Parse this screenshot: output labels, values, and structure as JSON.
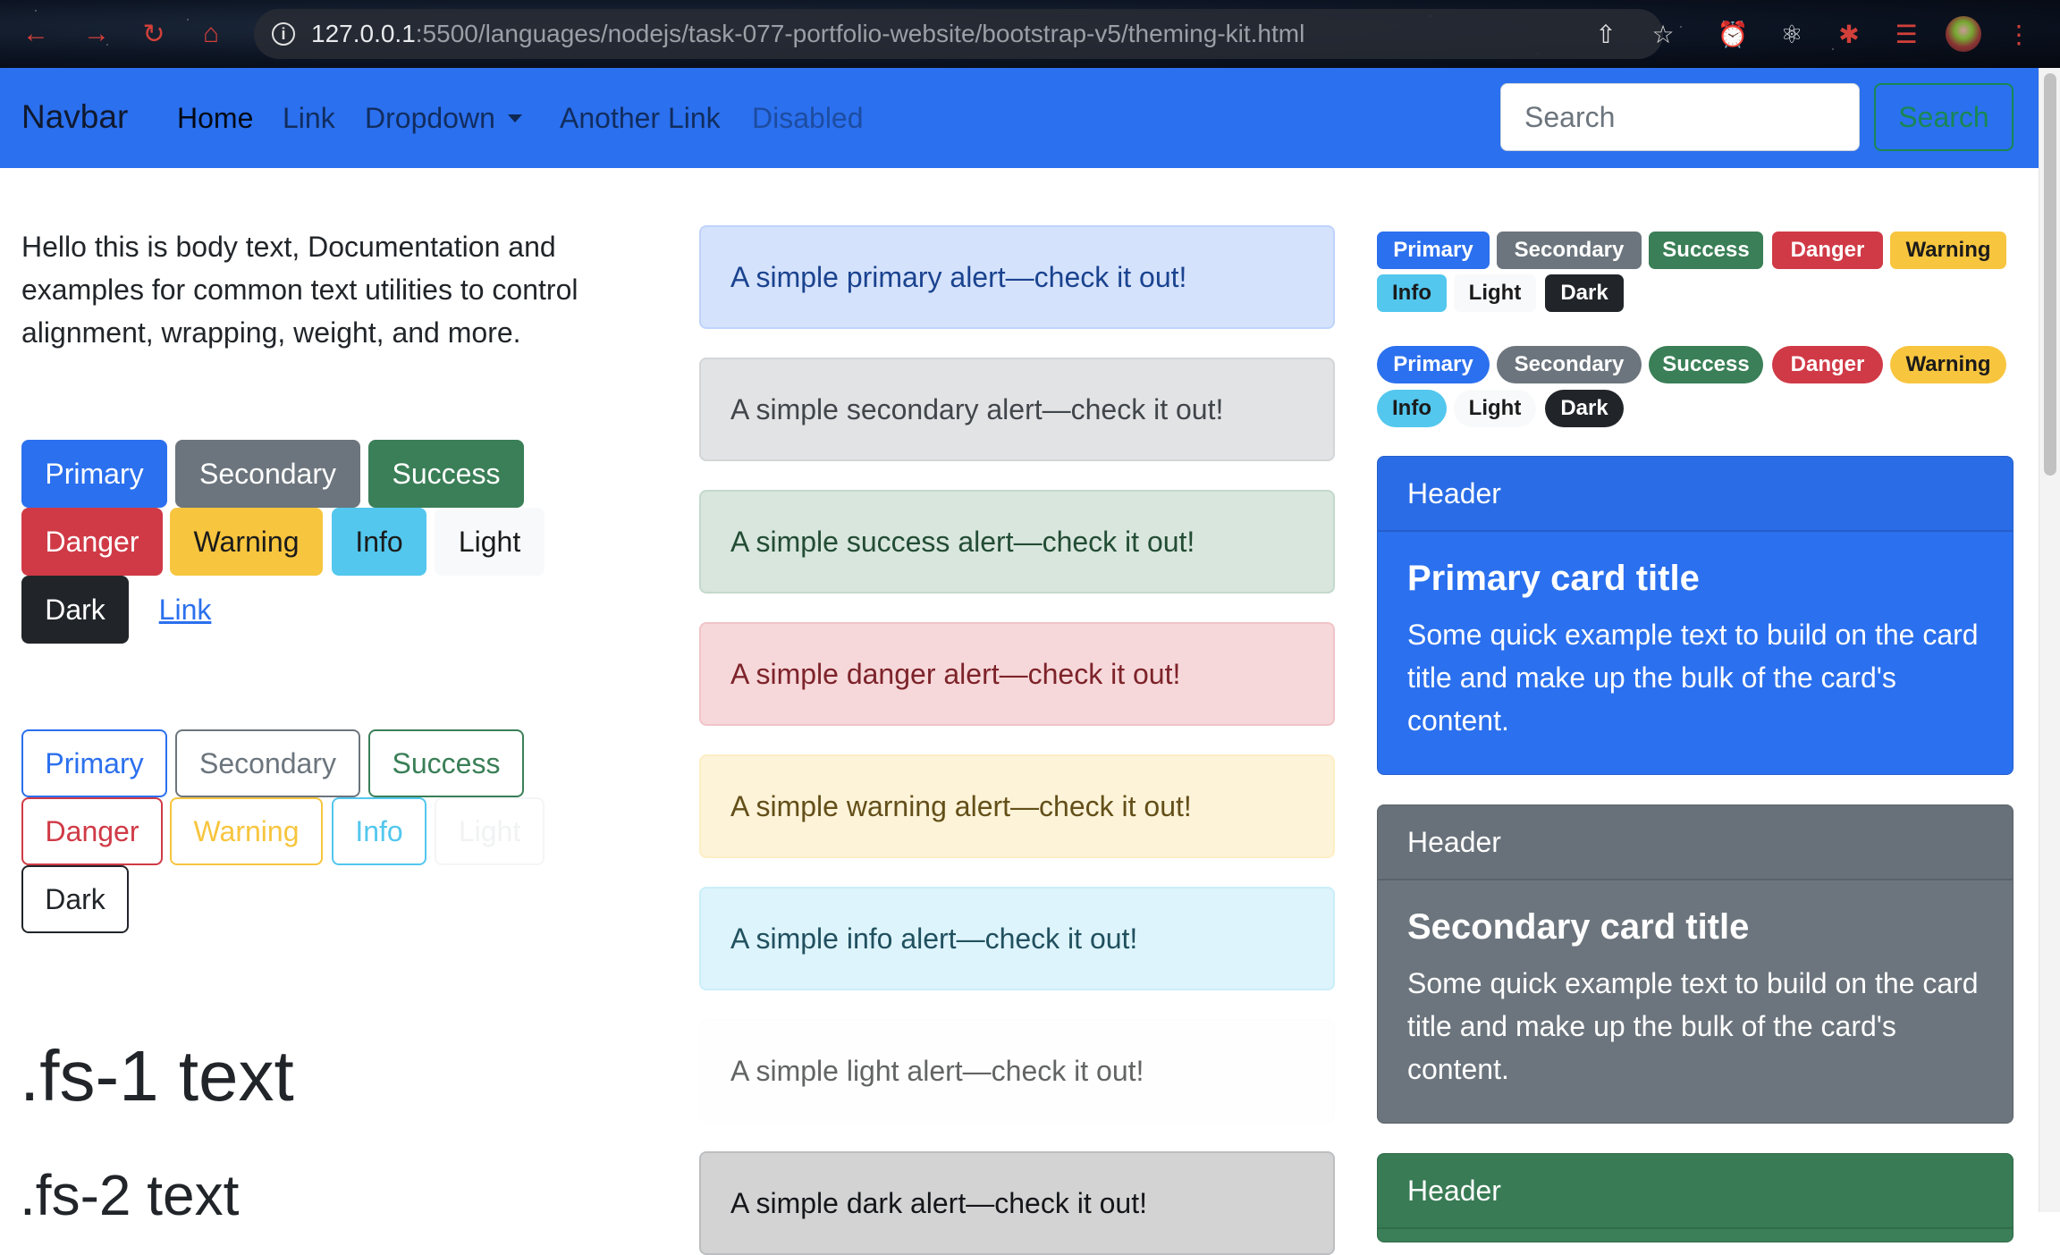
{
  "browser": {
    "url_host": "127.0.0.1",
    "url_path": ":5500/languages/nodejs/task-077-portfolio-website/bootstrap-v5/theming-kit.html"
  },
  "navbar": {
    "brand": "Navbar",
    "links": [
      "Home",
      "Link",
      "Dropdown",
      "Another Link",
      "Disabled"
    ],
    "search_placeholder": "Search",
    "search_button": "Search"
  },
  "body_text": "Hello this is body text, Documentation and examples for common text utilities to control alignment, wrapping, weight, and more.",
  "buttons": [
    "Primary",
    "Secondary",
    "Success",
    "Danger",
    "Warning",
    "Info",
    "Light",
    "Dark",
    "Link"
  ],
  "outline_buttons": [
    "Primary",
    "Secondary",
    "Success",
    "Danger",
    "Warning",
    "Info",
    "Light",
    "Dark"
  ],
  "headings": {
    "fs1": ".fs-1 text",
    "fs2": ".fs-2 text"
  },
  "alerts": [
    "A simple primary alert—check it out!",
    "A simple secondary alert—check it out!",
    "A simple success alert—check it out!",
    "A simple danger alert—check it out!",
    "A simple warning alert—check it out!",
    "A simple info alert—check it out!",
    "A simple light alert—check it out!",
    "A simple dark alert—check it out!"
  ],
  "badges": [
    "Primary",
    "Secondary",
    "Success",
    "Danger",
    "Warning",
    "Info",
    "Light",
    "Dark"
  ],
  "pill_badges": [
    "Primary",
    "Secondary",
    "Success",
    "Danger",
    "Warning",
    "Info",
    "Light",
    "Dark"
  ],
  "cards": [
    {
      "header": "Header",
      "title": "Primary card title",
      "text": "Some quick example text to build on the card title and make up the bulk of the card's content."
    },
    {
      "header": "Header",
      "title": "Secondary card title",
      "text": "Some quick example text to build on the card title and make up the bulk of the card's content."
    },
    {
      "header": "Header"
    }
  ],
  "colors": {
    "primary": "#2b70ee",
    "secondary": "#6c757d",
    "success": "#3a7f57",
    "danger": "#d03a46",
    "warning": "#f7c53e",
    "info": "#53c7ee",
    "light": "#f8f9fa",
    "dark": "#212529"
  }
}
